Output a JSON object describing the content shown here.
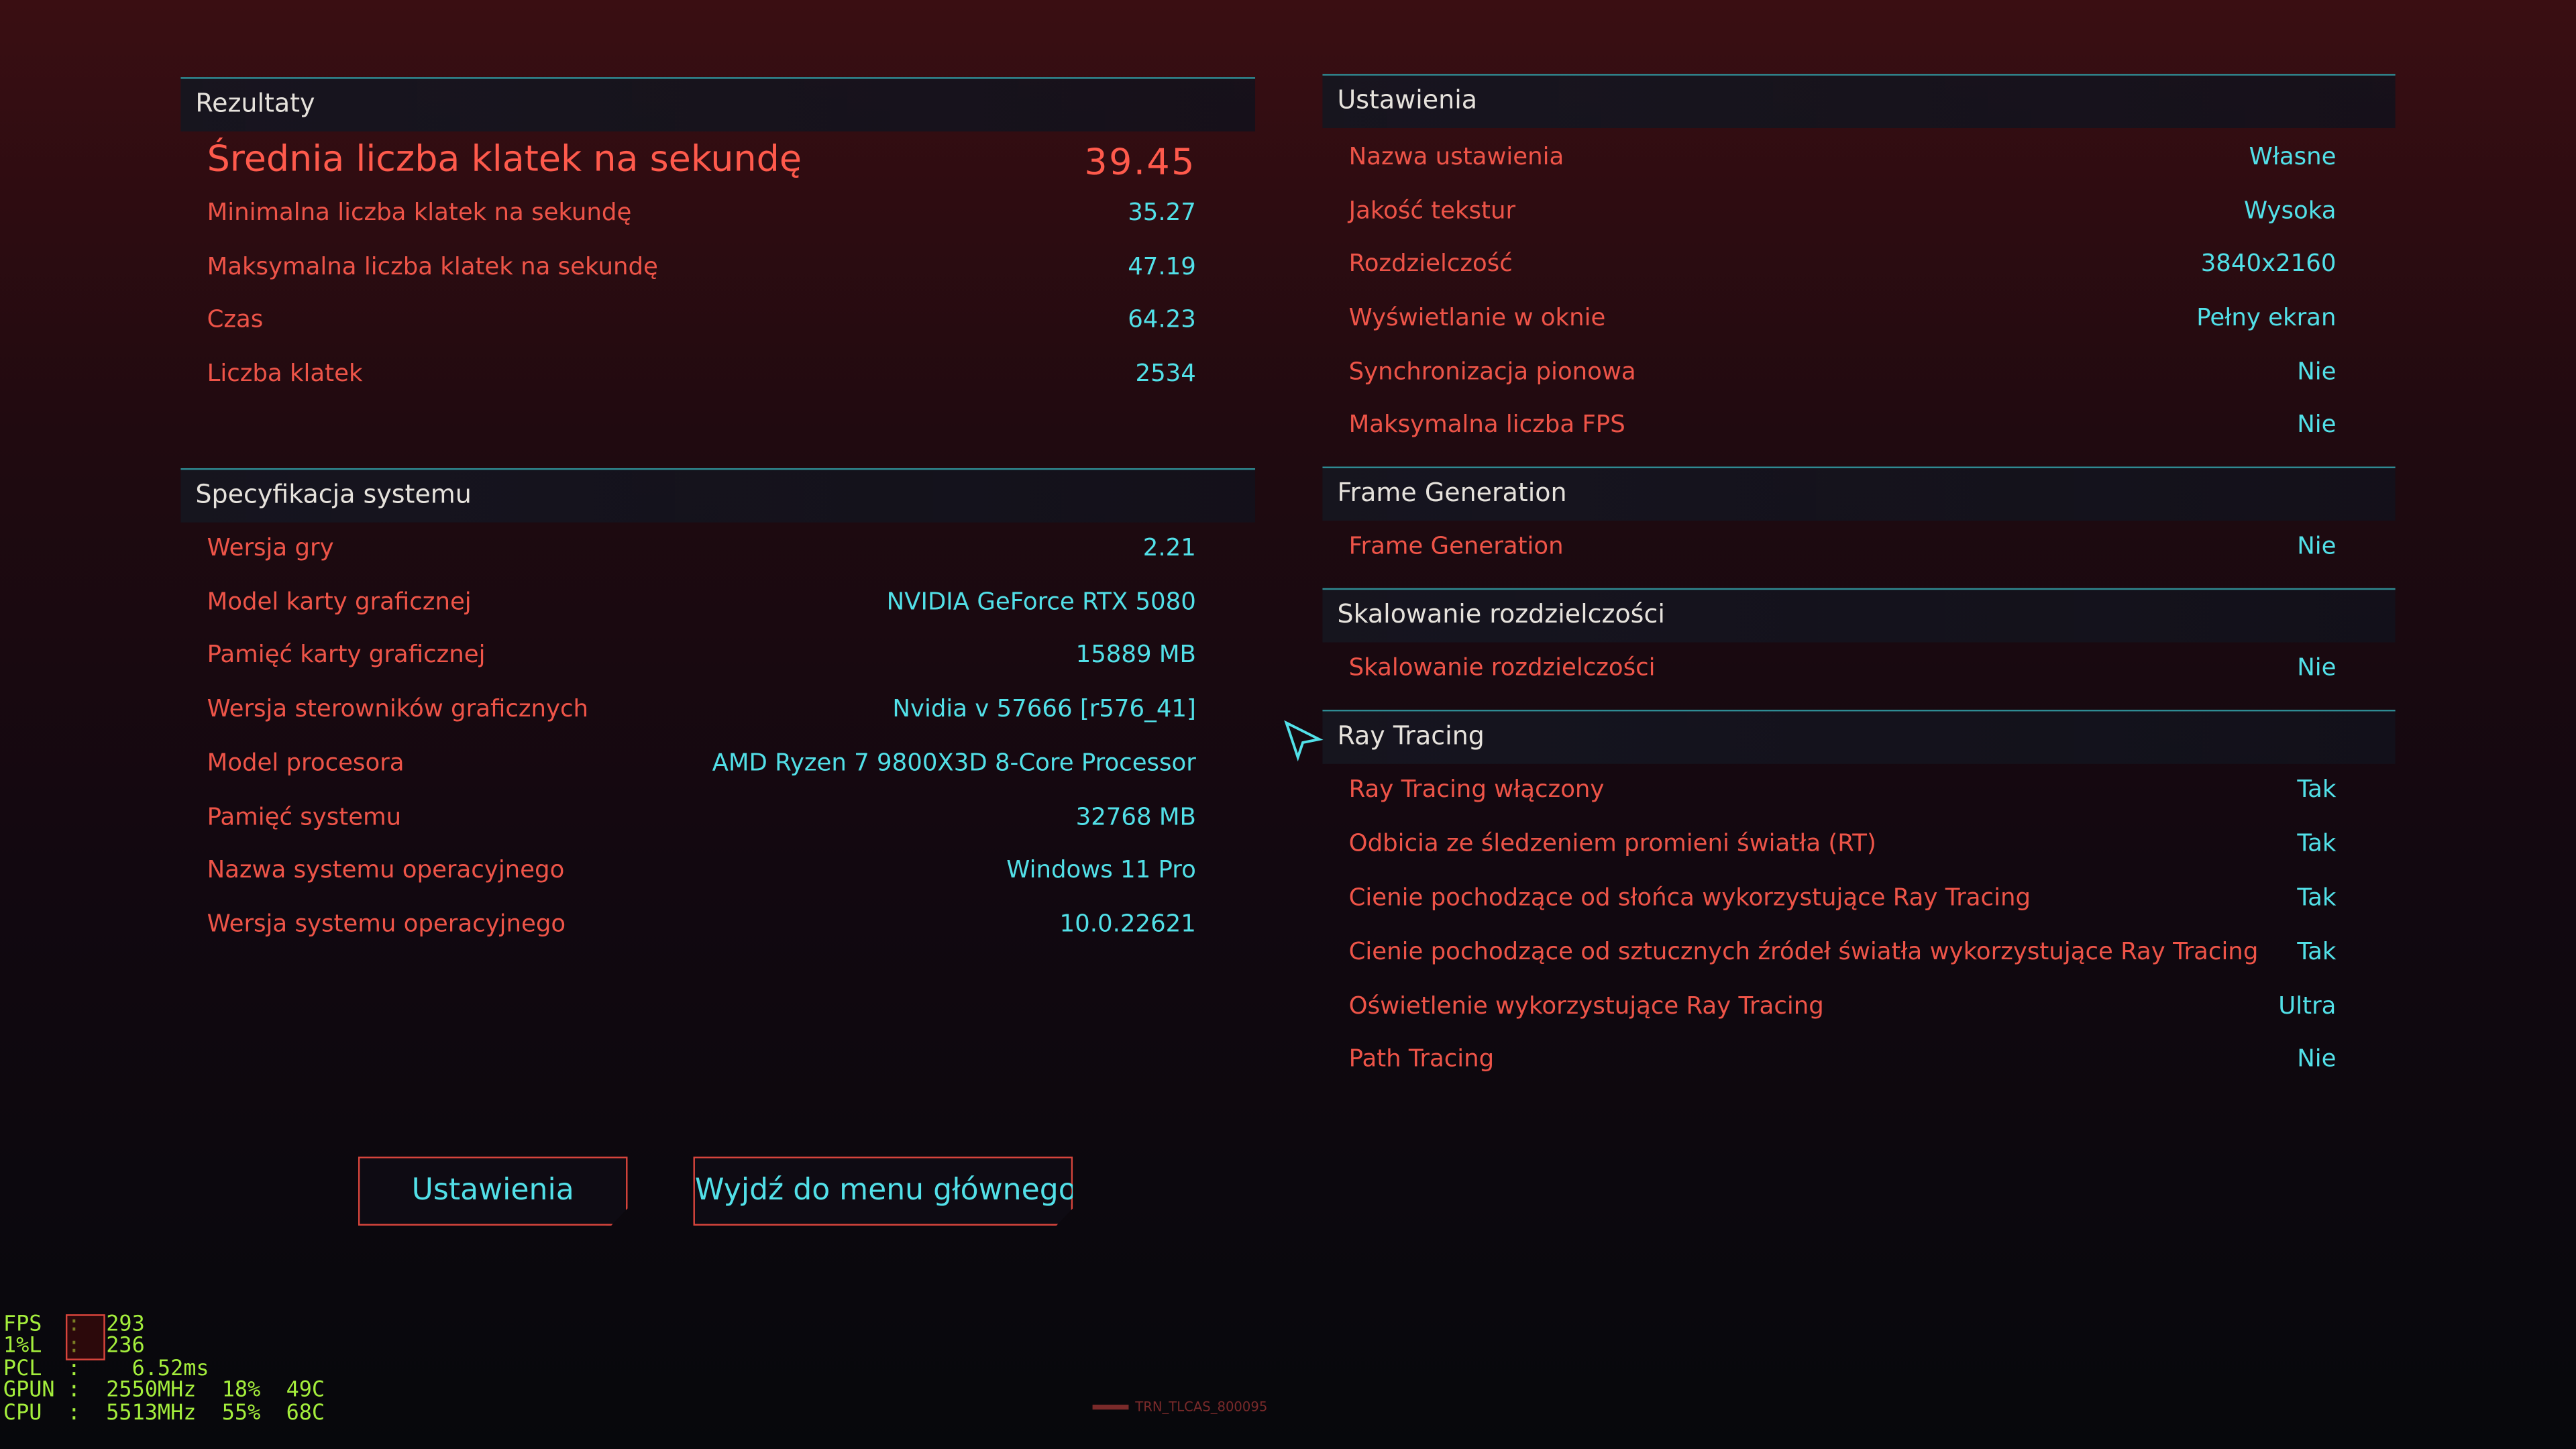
{
  "results": {
    "title": "Rezultaty",
    "avg_fps_label": "Średnia liczba klatek na sekundę",
    "avg_fps_value": "39.45",
    "rows": [
      {
        "label": "Minimalna liczba klatek na sekundę",
        "value": "35.27"
      },
      {
        "label": "Maksymalna liczba klatek na sekundę",
        "value": "47.19"
      },
      {
        "label": "Czas",
        "value": "64.23"
      },
      {
        "label": "Liczba klatek",
        "value": "2534"
      }
    ]
  },
  "system": {
    "title": "Specyfikacja systemu",
    "rows": [
      {
        "label": "Wersja gry",
        "value": "2.21"
      },
      {
        "label": "Model karty graficznej",
        "value": "NVIDIA GeForce RTX 5080"
      },
      {
        "label": "Pamięć karty graficznej",
        "value": "15889 MB"
      },
      {
        "label": "Wersja sterowników graficznych",
        "value": "Nvidia v 57666 [r576_41]"
      },
      {
        "label": "Model procesora",
        "value": "AMD Ryzen 7 9800X3D 8-Core Processor"
      },
      {
        "label": "Pamięć systemu",
        "value": "32768 MB"
      },
      {
        "label": "Nazwa systemu operacyjnego",
        "value": "Windows 11 Pro"
      },
      {
        "label": "Wersja systemu operacyjnego",
        "value": "10.0.22621"
      }
    ]
  },
  "settings": {
    "title": "Ustawienia",
    "rows": [
      {
        "label": "Nazwa ustawienia",
        "value": "Własne"
      },
      {
        "label": "Jakość tekstur",
        "value": "Wysoka"
      },
      {
        "label": "Rozdzielczość",
        "value": "3840x2160"
      },
      {
        "label": "Wyświetlanie w oknie",
        "value": "Pełny ekran"
      },
      {
        "label": "Synchronizacja pionowa",
        "value": "Nie"
      },
      {
        "label": "Maksymalna liczba FPS",
        "value": "Nie"
      }
    ]
  },
  "frame_generation": {
    "title": "Frame Generation",
    "rows": [
      {
        "label": "Frame Generation",
        "value": "Nie"
      }
    ]
  },
  "scaling": {
    "title": "Skalowanie rozdzielczości",
    "rows": [
      {
        "label": "Skalowanie rozdzielczości",
        "value": "Nie"
      }
    ]
  },
  "ray_tracing": {
    "title": "Ray Tracing",
    "rows": [
      {
        "label": "Ray Tracing włączony",
        "value": "Tak"
      },
      {
        "label": "Odbicia ze śledzeniem promieni światła (RT)",
        "value": "Tak"
      },
      {
        "label": "Cienie pochodzące od słońca wykorzystujące Ray Tracing",
        "value": "Tak"
      },
      {
        "label": "Cienie pochodzące od sztucznych źródeł światła wykorzystujące Ray Tracing",
        "value": "Tak"
      },
      {
        "label": "Oświetlenie wykorzystujące Ray Tracing",
        "value": "Ultra"
      },
      {
        "label": "Path Tracing",
        "value": "Nie"
      }
    ]
  },
  "buttons": {
    "settings": "Ustawienia",
    "exit": "Wyjdź do menu głównego"
  },
  "osd": {
    "lines": [
      "FPS  :  293",
      "1%L  :  236",
      "PCL  :    6.52ms",
      "GPUN :  2550MHz  18%  49C",
      "CPU  :  5513MHz  55%  68C"
    ],
    "footer": "TRN_TLCAS_800095"
  },
  "colors": {
    "label_red": "#ee5448",
    "value_cyan": "#52e0e8",
    "header_line": "#2f8c94",
    "osd_green": "#a4ee3c"
  }
}
